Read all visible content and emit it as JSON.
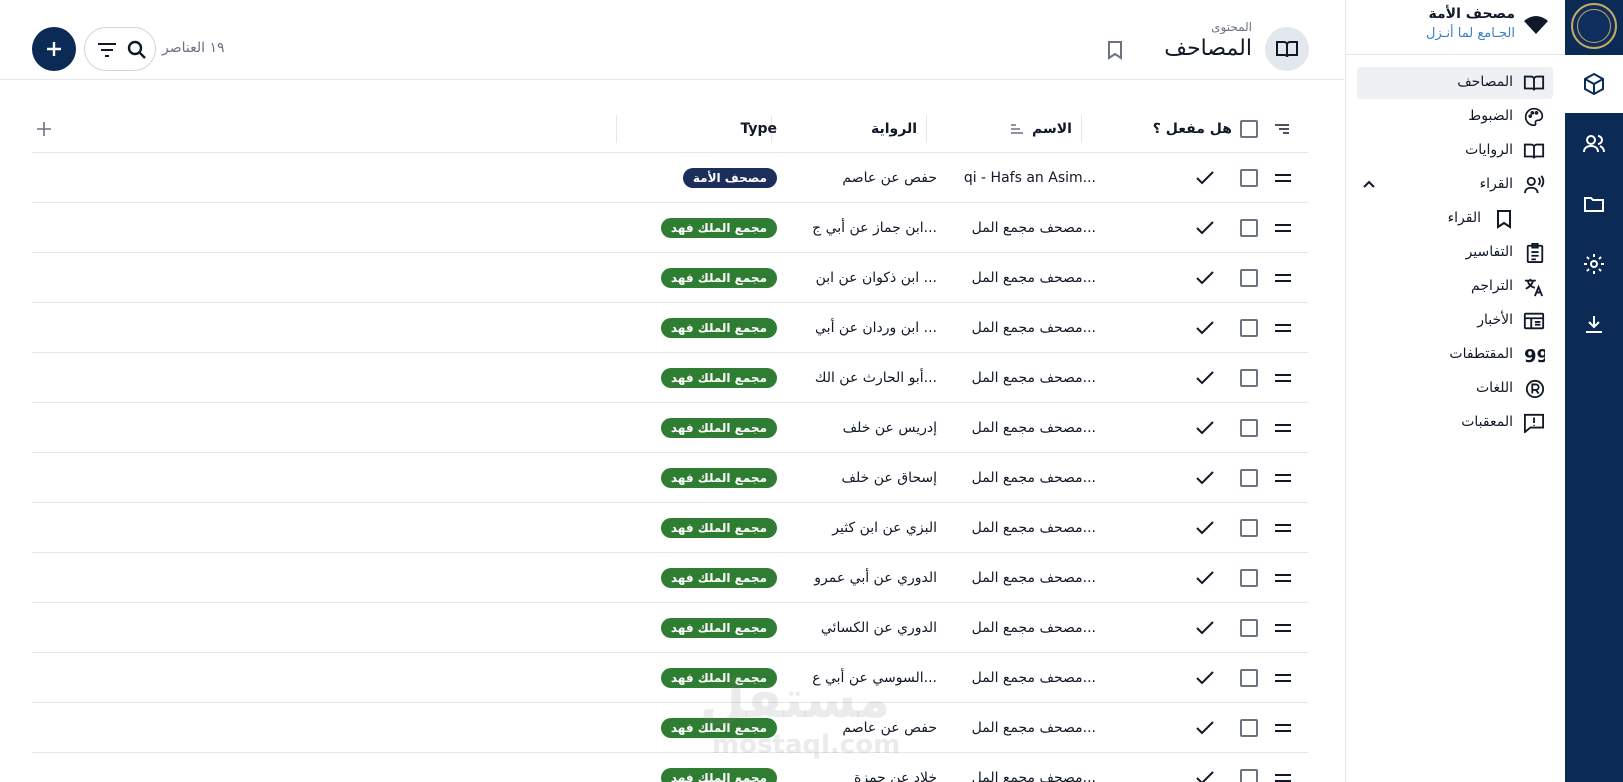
{
  "brand": {
    "title": "مصحف الأمة",
    "subtitle": "الجـامع لما أنـزل"
  },
  "sidebar": {
    "items": [
      {
        "label": "المصاحف",
        "icon": "book-open-icon"
      },
      {
        "label": "الضبوط",
        "icon": "palette-icon"
      },
      {
        "label": "الروايات",
        "icon": "book-open-icon"
      },
      {
        "label": "القراء",
        "icon": "reader-voice-icon"
      },
      {
        "label": "القراء",
        "icon": "bookmark-icon"
      },
      {
        "label": "التفاسير",
        "icon": "clipboard-icon"
      },
      {
        "label": "التراجم",
        "icon": "translate-icon"
      },
      {
        "label": "الأخبار",
        "icon": "news-icon"
      },
      {
        "label": "المقتطفات",
        "icon": "quote-icon"
      },
      {
        "label": "اللغات",
        "icon": "language-icon"
      },
      {
        "label": "المعقبات",
        "icon": "feedback-icon"
      }
    ]
  },
  "header": {
    "subtitle": "المحتوى",
    "title": "المصاحف",
    "count": "١٩ العناصر"
  },
  "table": {
    "columns": {
      "enabled": "هل مفعل ؟",
      "name": "الاسم",
      "riwaya": "الرواية",
      "type": "Type"
    },
    "rows": [
      {
        "name": "qi - Hafs an Asim...",
        "riwaya": "حفص عن عاصم",
        "type": "مصحف الأمة"
      },
      {
        "name": "مصحف مجمع المل...",
        "riwaya": "ابن جماز عن أبي ج...",
        "type": "مجمع الملك فهد"
      },
      {
        "name": "مصحف مجمع المل...",
        "riwaya": "ابن ذكوان عن ابن ...",
        "type": "مجمع الملك فهد"
      },
      {
        "name": "مصحف مجمع المل...",
        "riwaya": "ابن وردان عن أبي ...",
        "type": "مجمع الملك فهد"
      },
      {
        "name": "مصحف مجمع المل...",
        "riwaya": "أبو الحارث عن الك...",
        "type": "مجمع الملك فهد"
      },
      {
        "name": "مصحف مجمع المل...",
        "riwaya": "إدريس عن خلف",
        "type": "مجمع الملك فهد"
      },
      {
        "name": "مصحف مجمع المل...",
        "riwaya": "إسحاق عن خلف",
        "type": "مجمع الملك فهد"
      },
      {
        "name": "مصحف مجمع المل...",
        "riwaya": "البزي عن ابن كثير",
        "type": "مجمع الملك فهد"
      },
      {
        "name": "مصحف مجمع المل...",
        "riwaya": "الدوري عن أبي عمرو",
        "type": "مجمع الملك فهد"
      },
      {
        "name": "مصحف مجمع المل...",
        "riwaya": "الدوري عن الكسائي",
        "type": "مجمع الملك فهد"
      },
      {
        "name": "مصحف مجمع المل...",
        "riwaya": "السوسي عن أبي ع...",
        "type": "مجمع الملك فهد"
      },
      {
        "name": "مصحف مجمع المل...",
        "riwaya": "حفص عن عاصم",
        "type": "مجمع الملك فهد"
      },
      {
        "name": "مصحف مجمع المل...",
        "riwaya": "خلاد عن حمزة",
        "type": "مجمع الملك فهد"
      }
    ]
  },
  "watermark": {
    "line1": "مستقل",
    "line2": "mostaql.com"
  },
  "colors": {
    "navy": "#0b2a55",
    "green_badge": "#2e7d32",
    "navy_badge": "#1c2f5c"
  }
}
